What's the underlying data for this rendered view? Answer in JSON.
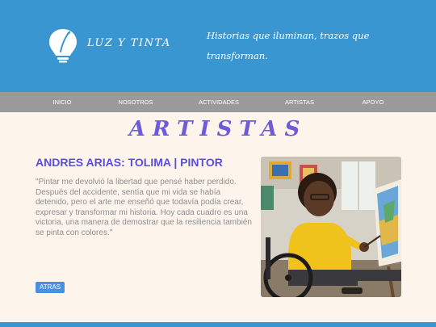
{
  "header": {
    "brand": "LUZ Y TINTA",
    "tagline": "Historias que iluminan, trazos que transforman."
  },
  "nav": {
    "items": [
      "INICIO",
      "NOSOTROS",
      "ACTIVIDADES",
      "ARTISTAS",
      "APOYO"
    ]
  },
  "main": {
    "title": "ARTISTAS",
    "artist_name": "ANDRES ARIAS: TOLIMA | PINTOR",
    "quote": "\"Pintar me devolvió la libertad que pensé haber perdido. Después del accidente, sentía que mi vida se había detenido, pero el arte me enseñó que todavía podía crear, expresar y transformar mi historia. Hoy cada cuadro es una victoria, una manera de demostrar que la resiliencia también se pinta con colores.\"",
    "back_label": "ATRAS"
  },
  "colors": {
    "header": "#3a96d0",
    "nav": "#9a9a9a",
    "title": "#6f5bd8",
    "artist_name": "#5b4de0",
    "button": "#4a90e2",
    "background": "#fdf5ec"
  }
}
